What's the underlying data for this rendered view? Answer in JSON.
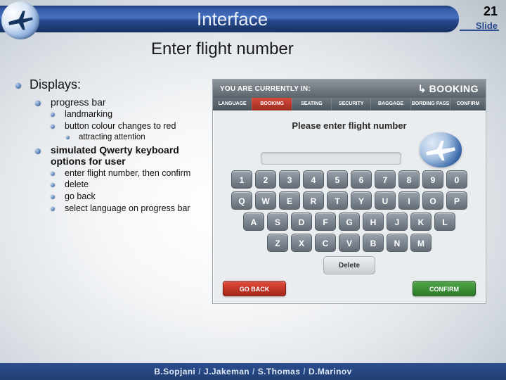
{
  "slide": {
    "number": "21",
    "label": "Slide",
    "title": "Interface",
    "subtitle": "Enter flight number"
  },
  "bullets": {
    "displays": "Displays:",
    "progress_bar": "progress bar",
    "landmarking": "landmarking",
    "button_colour": "button colour changes to red",
    "attracting": "attracting attention",
    "qwerty": "simulated Qwerty keyboard options for user",
    "enter_confirm": "enter flight number, then confirm",
    "delete": "delete",
    "go_back": "go back",
    "select_lang": "select language on progress bar"
  },
  "app": {
    "you_in": "YOU  ARE  CURRENTLY  IN:",
    "section": "BOOKING",
    "tabs": [
      "LANGUAGE",
      "BOOKING",
      "SEATING",
      "SECURITY",
      "BAGGAGE",
      "BORDING PASS",
      "CONFIRM"
    ],
    "prompt": "Please enter flight number",
    "rows": [
      [
        "1",
        "2",
        "3",
        "4",
        "5",
        "6",
        "7",
        "8",
        "9",
        "0"
      ],
      [
        "Q",
        "W",
        "E",
        "R",
        "T",
        "Y",
        "U",
        "I",
        "O",
        "P"
      ],
      [
        "A",
        "S",
        "D",
        "F",
        "G",
        "H",
        "J",
        "K",
        "L"
      ],
      [
        "Z",
        "X",
        "C",
        "V",
        "B",
        "N",
        "M"
      ]
    ],
    "delete": "Delete",
    "go_back": "GO BACK",
    "confirm": "CONFIRM"
  },
  "footer": {
    "a": "B.Sopjani",
    "b": "J.Jakeman",
    "c": "S.Thomas",
    "d": "D.Marinov"
  }
}
